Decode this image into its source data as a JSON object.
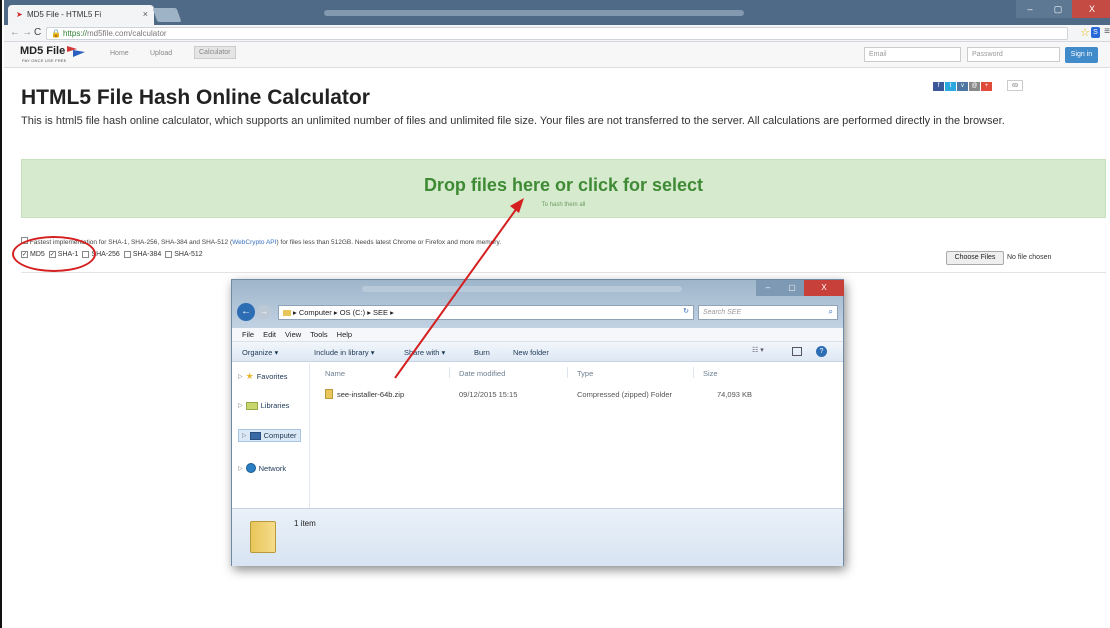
{
  "browser": {
    "tab_title": "MD5 File - HTML5 Fi",
    "tab_close": "×",
    "url_scheme": "https://",
    "url_rest": "md5file.com/calculator",
    "win_min": "–",
    "win_max": "▢",
    "win_close": "X"
  },
  "site": {
    "brand": "MD5 File",
    "brand_tagline": "PAY ONCE USE FREE",
    "nav": [
      "Home",
      "Upload",
      "Calculator"
    ],
    "email_placeholder": "Email",
    "password_placeholder": "Password",
    "signin_label": "Sign in",
    "social_count": "69"
  },
  "page": {
    "title": "HTML5 File Hash Online Calculator",
    "intro": "This is html5 file hash online calculator, which supports an unlimited number of files and unlimited file size. Your files are not transferred to the server. All calculations are performed directly in the browser.",
    "drop_title": "Drop files here or click for select",
    "drop_sub": "To hash them all",
    "fast_pre": "Fastest implementation for SHA-1, SHA-256, SHA-384 and SHA-512 (",
    "fast_link": "WebCrypto API",
    "fast_post": ") for files less than 512GB. Needs latest Chrome or Firefox and more memory.",
    "algorithms": [
      {
        "label": "MD5",
        "checked": true
      },
      {
        "label": "SHA-1",
        "checked": true
      },
      {
        "label": "SHA-256",
        "checked": false
      },
      {
        "label": "SHA-384",
        "checked": false
      },
      {
        "label": "SHA-512",
        "checked": false
      }
    ],
    "choose_files": "Choose Files",
    "no_file": "No file chosen"
  },
  "explorer": {
    "address": "▸ Computer ▸ OS (C:) ▸ SEE ▸",
    "search_placeholder": "Search SEE",
    "menu": [
      "File",
      "Edit",
      "View",
      "Tools",
      "Help"
    ],
    "commands": [
      "Organize ▾",
      "Include in library ▾",
      "Share with ▾",
      "Burn",
      "New folder"
    ],
    "nav": [
      "Favorites",
      "Libraries",
      "Computer",
      "Network"
    ],
    "columns": [
      "Name",
      "Date modified",
      "Type",
      "Size"
    ],
    "file": {
      "name": "see-installer-64b.zip",
      "date": "09/12/2015 15:15",
      "type": "Compressed (zipped) Folder",
      "size": "74,093 KB"
    },
    "item_count": "1 item"
  },
  "colors": {
    "accent": "#428bca",
    "dropzone": "#d6ebce",
    "drop_text": "#3f8a35",
    "annotation": "#d42020"
  }
}
